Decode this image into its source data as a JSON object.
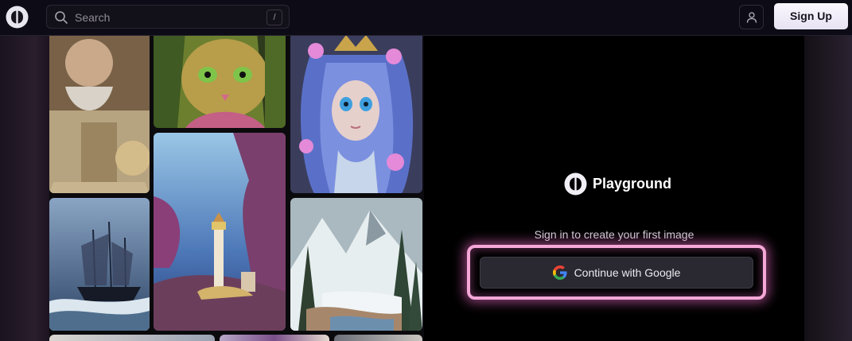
{
  "header": {
    "search": {
      "placeholder": "Search",
      "shortcut": "/"
    },
    "signup_label": "Sign Up"
  },
  "gallery": {
    "tiles": [
      "elderly-man-portrait",
      "ornate-cat-portrait",
      "blue-haired-doll-portrait",
      "ship-in-storm",
      "lighthouse-fantasy",
      "snowy-mountain-forest"
    ]
  },
  "auth_panel": {
    "brand_name": "Playground",
    "tagline": "Sign in to create your first image",
    "google_button_label": "Continue with Google"
  },
  "colors": {
    "accent_glow": "#f5a8d8",
    "panel_bg": "#000000",
    "topbar_bg": "#0d0b16"
  }
}
